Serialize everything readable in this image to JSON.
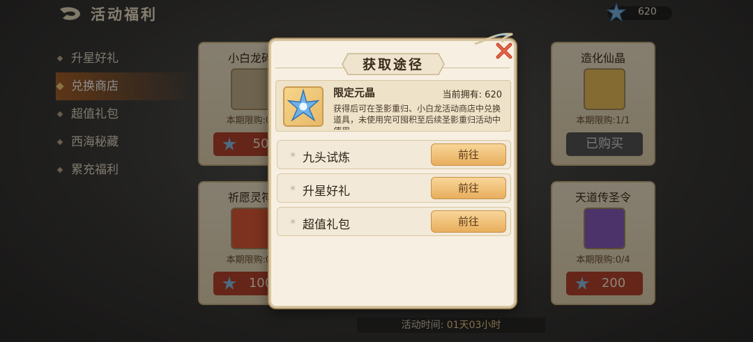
{
  "header": {
    "title": "活动福利",
    "currency_value": "620"
  },
  "sidebar": {
    "items": [
      {
        "label": "升星好礼",
        "active": false
      },
      {
        "label": "兑换商店",
        "active": true
      },
      {
        "label": "超值礼包",
        "active": false
      },
      {
        "label": "西海秘藏",
        "active": false
      },
      {
        "label": "累充福利",
        "active": false
      }
    ]
  },
  "shop": {
    "cards": [
      {
        "title": "小白龙碎",
        "limit": "本期限购:0/",
        "price": "50"
      },
      {
        "title": "造化仙晶",
        "limit": "本期限购:1/1",
        "button": "已购买"
      },
      {
        "title": "祈愿灵符",
        "limit": "本期限购:0/",
        "price": "100"
      },
      {
        "title": "天道传圣令",
        "limit": "本期限购:0/4",
        "price": "200"
      }
    ],
    "time_label": "活动时间: ",
    "time_value": "01天03小时"
  },
  "modal": {
    "title": "获取途径",
    "item": {
      "name": "限定元晶",
      "owned_label": "当前拥有: 620",
      "description": "获得后可在圣影重归、小白龙活动商店中兑换道具，未使用完可囤积至后续圣影重归活动中使用"
    },
    "routes": [
      {
        "label": "九头试炼",
        "button": "前往"
      },
      {
        "label": "升星好礼",
        "button": "前往"
      },
      {
        "label": "超值礼包",
        "button": "前往"
      }
    ]
  },
  "colors": {
    "accent": "#e8ae5e",
    "buy_button": "#b8452f",
    "modal_bg": "#f7f0e2"
  }
}
